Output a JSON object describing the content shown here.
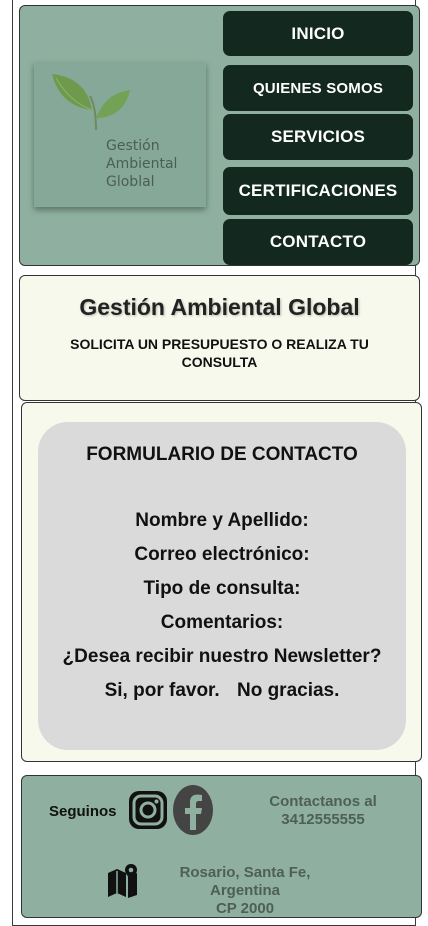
{
  "brand": {
    "logo_lines": [
      "Gestión",
      "Ambiental",
      "Globlal"
    ]
  },
  "nav": {
    "items": [
      {
        "label": "INICIO"
      },
      {
        "label": "QUIENES SOMOS"
      },
      {
        "label": "SERVICIOS"
      },
      {
        "label": "CERTIFICACIONES"
      },
      {
        "label": "CONTACTO"
      }
    ]
  },
  "intro": {
    "title": "Gestión Ambiental Global",
    "subtitle": "SOLICITA UN PRESUPUESTO O REALIZA TU CONSULTA"
  },
  "form": {
    "title": "FORMULARIO DE CONTACTO",
    "fields": [
      {
        "label": "Nombre y Apellido:"
      },
      {
        "label": "Correo electrónico:"
      },
      {
        "label": "Tipo de consulta:"
      },
      {
        "label": "Comentarios:"
      }
    ],
    "newsletter_question": "¿Desea recibir nuestro Newsletter?",
    "option_yes": "Si, por favor.",
    "option_no": "No gracias."
  },
  "footer": {
    "follow_label": "Seguinos",
    "contact_line1": "Contactanos al",
    "contact_phone": "3412555555",
    "address_line1": "Rosario, Santa Fe, Argentina",
    "address_line2": "CP 2000",
    "icons": [
      "instagram-icon",
      "facebook-icon",
      "map-pin-icon"
    ]
  },
  "colors": {
    "header_bg": "#8fb0a0",
    "nav_button_bg": "#13291f",
    "card_bg": "#f7f9ec",
    "form_card_bg": "#dadada",
    "muted_text": "#4e5f57"
  }
}
